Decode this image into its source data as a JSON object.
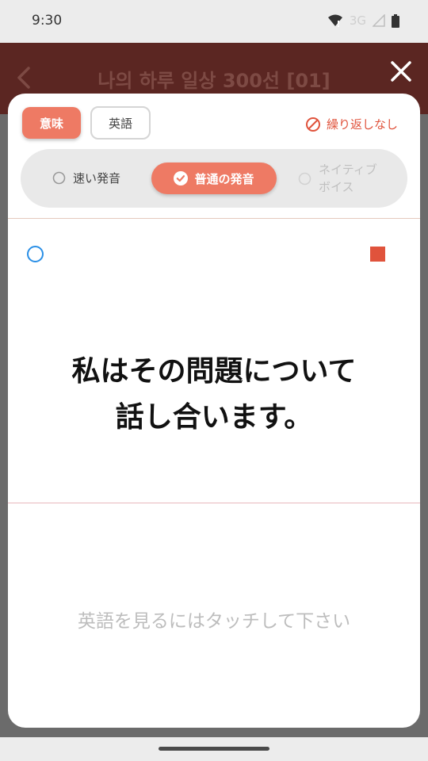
{
  "status": {
    "time": "9:30",
    "network": "3G"
  },
  "header": {
    "title": "나의 하루 일상 300선 [01]"
  },
  "toggles": {
    "meaning_label": "意味",
    "english_label": "英語"
  },
  "repeat": {
    "label": "繰り返しなし"
  },
  "speed": {
    "fast_label": "速い発音",
    "normal_label": "普通の発音",
    "native_line1": "ネイティブ",
    "native_line2": "ボイス",
    "selected": "普通の発音"
  },
  "card": {
    "sentence_line1": "私はその問題について",
    "sentence_line2": "話し合います。",
    "touch_hint": "英語を見るにはタッチして下さい"
  },
  "colors": {
    "accent": "#ee7a64",
    "header": "#5b2622",
    "danger": "#e0533c",
    "play": "#2a8fe6"
  }
}
